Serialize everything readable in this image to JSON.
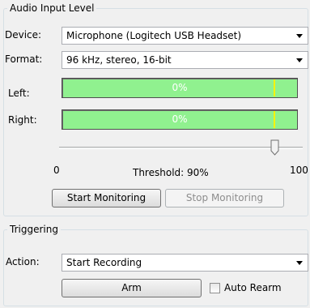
{
  "audio_input": {
    "group_title": "Audio Input Level",
    "device": {
      "label": "Device:",
      "value": "Microphone (Logitech USB Headset)"
    },
    "format": {
      "label": "Format:",
      "value": "96 kHz, stereo, 16-bit"
    },
    "left": {
      "label": "Left:",
      "level_text": "0%",
      "level": 0,
      "threshold_marker": 0.9
    },
    "right": {
      "label": "Right:",
      "level_text": "0%",
      "level": 0,
      "threshold_marker": 0.9
    },
    "threshold": {
      "min_label": "0",
      "max_label": "100",
      "text": "Threshold: 90%",
      "value": 90
    },
    "start_button": "Start Monitoring",
    "stop_button": "Stop Monitoring"
  },
  "triggering": {
    "group_title": "Triggering",
    "action": {
      "label": "Action:",
      "value": "Start Recording"
    },
    "arm_button": "Arm",
    "auto_rearm_label": "Auto Rearm",
    "auto_rearm_checked": false
  },
  "colors": {
    "meter_fill": "#90f18f",
    "threshold_marker": "#f7f300",
    "group_border": "#d5dfe5"
  }
}
